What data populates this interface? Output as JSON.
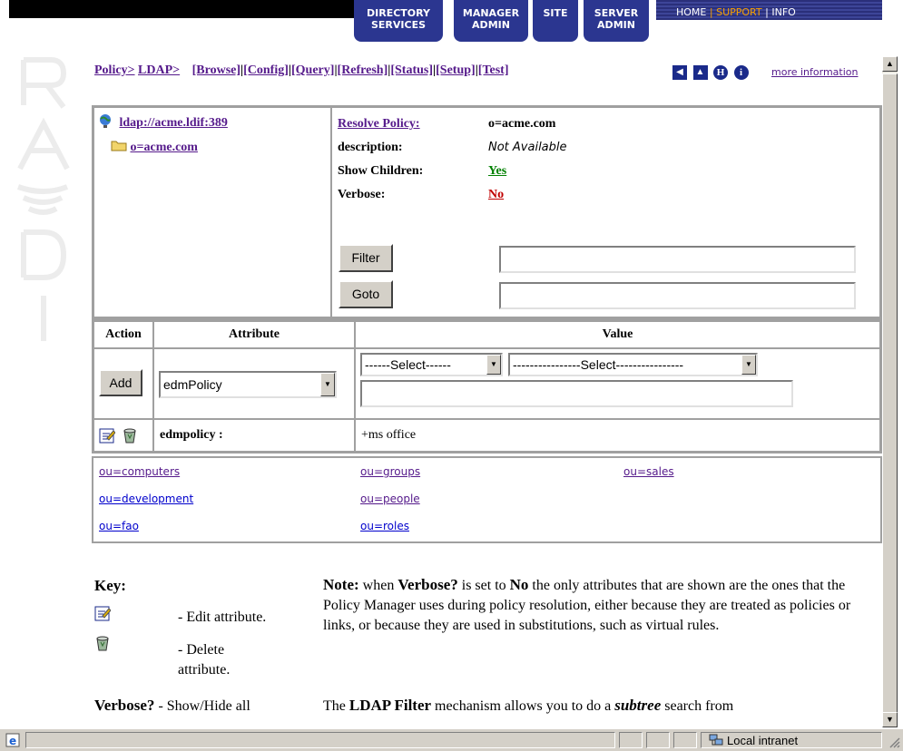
{
  "topnav": {
    "tabs": [
      {
        "line1": "DIRECTORY",
        "line2": "SERVICES"
      },
      {
        "line1": "MANAGER",
        "line2": "ADMIN"
      },
      {
        "line1": "SITE",
        "line2": ""
      },
      {
        "line1": "SERVER",
        "line2": "ADMIN"
      }
    ],
    "links": [
      "HOME",
      "SUPPORT",
      "INFO"
    ]
  },
  "breadcrumb": {
    "policy": "Policy>",
    "ldap": "LDAP>",
    "actions": [
      "[Browse]",
      "[Config]",
      "[Query]",
      "[Refresh]",
      "[Status]",
      "[Setup]",
      "[Test]"
    ],
    "more_info": "more information"
  },
  "tree": {
    "root": "ldap://acme.ldif:389",
    "child": "o=acme.com"
  },
  "details": {
    "resolve_policy_label": "Resolve Policy:",
    "resolve_policy_value": "o=acme.com",
    "description_label": "description:",
    "description_value": "Not Available",
    "show_children_label": "Show Children:",
    "show_children_value": "Yes",
    "verbose_label": "Verbose:",
    "verbose_value": "No",
    "filter_button": "Filter",
    "goto_button": "Goto",
    "filter_value": "",
    "goto_value": ""
  },
  "attributes": {
    "headers": {
      "action": "Action",
      "attribute": "Attribute",
      "value": "Value"
    },
    "add_button": "Add",
    "attribute_select": "edmPolicy",
    "value_select1": "------Select------",
    "value_select2": "----------------Select----------------",
    "value_input": "",
    "row": {
      "name": "edmpolicy :",
      "value": "+ms office"
    }
  },
  "children": {
    "col1": [
      "ou=computers",
      "ou=development",
      "ou=fao"
    ],
    "col2": [
      "ou=groups",
      "ou=people",
      "ou=roles"
    ],
    "col3": [
      "ou=sales"
    ]
  },
  "key": {
    "title": "Key:",
    "edit": "- Edit attribute.",
    "delete_line1": "- Delete",
    "delete_line2": "attribute.",
    "verbose_label": "Verbose?",
    "verbose_desc": "- Show/Hide all"
  },
  "note": {
    "note_label": "Note:",
    "p1_a": " when ",
    "p1_verbose": "Verbose?",
    "p1_b": " is set to ",
    "p1_no": "No",
    "p1_c": " the only attributes that are shown are the ones that the Policy Manager uses during policy resolution, either because they are treated as policies or links, or because they are used in substitutions, such as virtual rules.",
    "p2_a": "The ",
    "p2_filter": "LDAP Filter",
    "p2_b": " mechanism allows you to do a ",
    "p2_subtree": "subtree",
    "p2_c": " search from"
  },
  "statusbar": {
    "zone": "Local intranet"
  },
  "colors": {
    "nav_blue": "#2b3690",
    "link_visited": "#551a8b",
    "link_blue": "#0000cc",
    "yes_green": "#008000",
    "no_red": "#c00000"
  }
}
